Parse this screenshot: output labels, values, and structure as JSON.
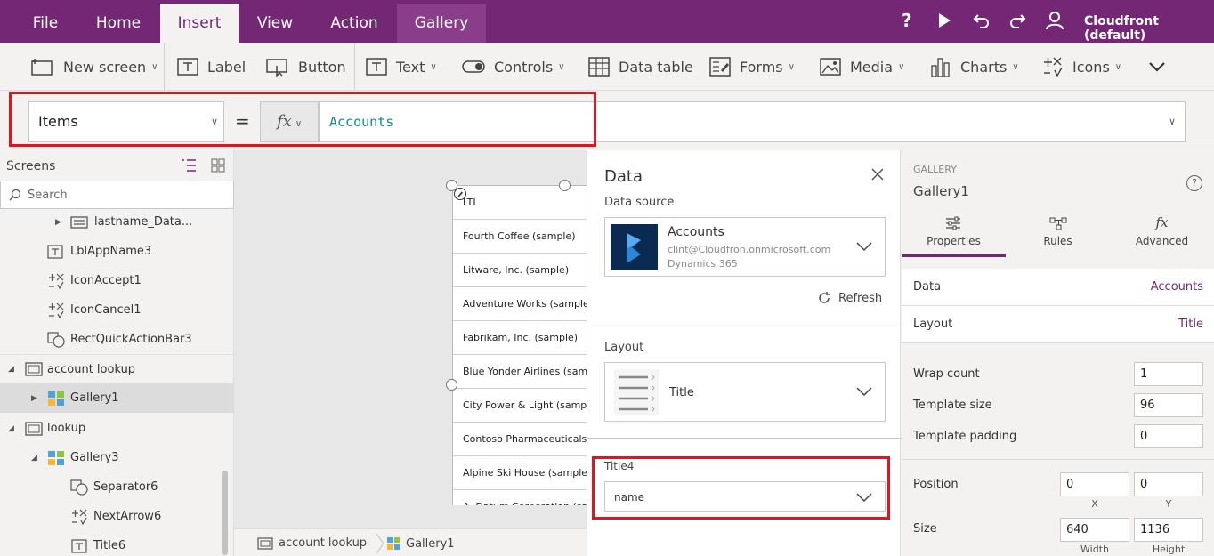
{
  "menu": {
    "file": "File",
    "home": "Home",
    "insert": "Insert",
    "view": "View",
    "action": "Action",
    "gallery": "Gallery",
    "account": "Cloudfront (default)"
  },
  "ribbon": {
    "new_screen": "New screen",
    "label": "Label",
    "button": "Button",
    "text": "Text",
    "controls": "Controls",
    "data_table": "Data table",
    "forms": "Forms",
    "media": "Media",
    "charts": "Charts",
    "icons": "Icons"
  },
  "formula": {
    "property": "Items",
    "equals": "=",
    "fx": "fx",
    "value": "Accounts"
  },
  "tree": {
    "title": "Screens",
    "search_placeholder": "Search",
    "items": [
      {
        "label": "lastname_Data..."
      },
      {
        "label": "LblAppName3"
      },
      {
        "label": "IconAccept1"
      },
      {
        "label": "IconCancel1"
      },
      {
        "label": "RectQuickActionBar3"
      },
      {
        "label": "account lookup"
      },
      {
        "label": "Gallery1"
      },
      {
        "label": "lookup"
      },
      {
        "label": "Gallery3"
      },
      {
        "label": "Separator6"
      },
      {
        "label": "NextArrow6"
      },
      {
        "label": "Title6"
      }
    ]
  },
  "gallery": {
    "items": [
      "LTI",
      "Fourth Coffee (sample)",
      "Litware, Inc. (sample)",
      "Adventure Works (sample)",
      "Fabrikam, Inc. (sample)",
      "Blue Yonder Airlines (sample)",
      "City Power & Light (sample)",
      "Contoso Pharmaceuticals (sample)",
      "Alpine Ski House (sample)",
      "A. Datum Corporation (sample)"
    ]
  },
  "breadcrumb": {
    "screen": "account lookup",
    "control": "Gallery1"
  },
  "data_pane": {
    "title": "Data",
    "source_label": "Data source",
    "source_name": "Accounts",
    "source_email": "clint@Cloudfron.onmicrosoft.com",
    "source_type": "Dynamics 365",
    "refresh": "Refresh",
    "layout_label": "Layout",
    "layout_value": "Title",
    "title_field_label": "Title4",
    "title_field_value": "name"
  },
  "properties": {
    "type": "GALLERY",
    "name": "Gallery1",
    "tabs": [
      "Properties",
      "Rules",
      "Advanced"
    ],
    "data_label": "Data",
    "data_value": "Accounts",
    "layout_label": "Layout",
    "layout_value": "Title",
    "wrap_count_label": "Wrap count",
    "wrap_count": "1",
    "template_size_label": "Template size",
    "template_size": "96",
    "template_padding_label": "Template padding",
    "template_padding": "0",
    "position_label": "Position",
    "pos_x": "0",
    "pos_y": "0",
    "x_label": "X",
    "y_label": "Y",
    "size_label": "Size",
    "width": "640",
    "height": "1136",
    "width_label": "Width",
    "height_label": "Height"
  },
  "colors": {
    "brand": "#742774",
    "highlight": "#e8121e",
    "formula_text": "#1a8a8a"
  }
}
